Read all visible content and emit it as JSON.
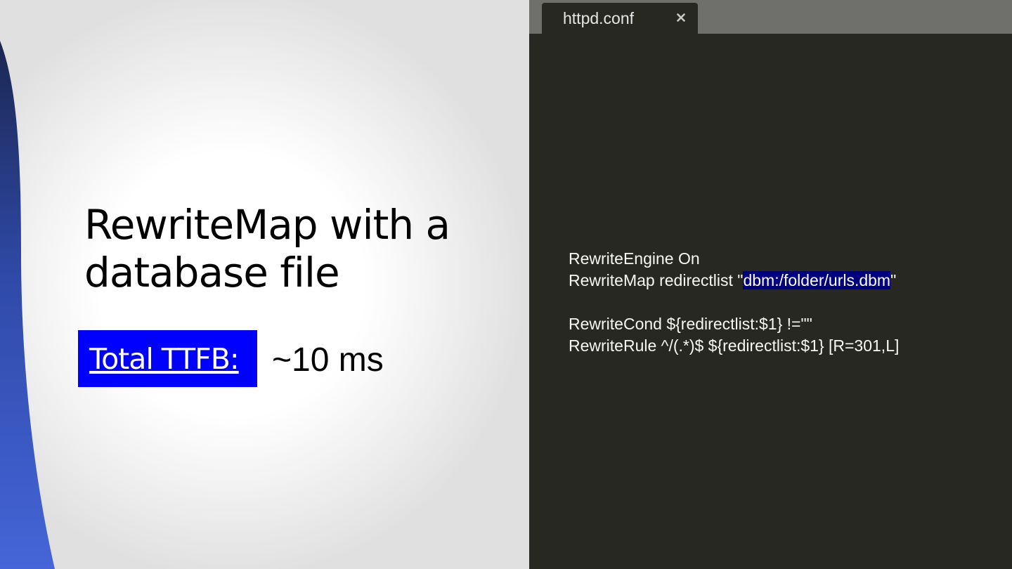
{
  "slide": {
    "title_line1": "RewriteMap with a",
    "title_line2": "database file",
    "ttfb_label": "Total TTFB:",
    "ttfb_value": "~10 ms",
    "ttfb_box_color": "#0000ff",
    "accent_gradient": [
      "#1b2c63",
      "#3f5fd6"
    ]
  },
  "editor": {
    "tab_title": "httpd.conf",
    "close_icon": "close-icon",
    "background": "#272822",
    "highlight_color": "#00007f",
    "code": {
      "line1": "RewriteEngine On",
      "line2_prefix": "RewriteMap redirectlist \"",
      "line2_highlight": "dbm:/folder/urls.dbm",
      "line2_suffix": "\"",
      "line3": "",
      "line4": "RewriteCond ${redirectlist:$1} !=\"\"",
      "line5": "RewriteRule ^/(.*)$ ${redirectlist:$1} [R=301,L]"
    }
  }
}
